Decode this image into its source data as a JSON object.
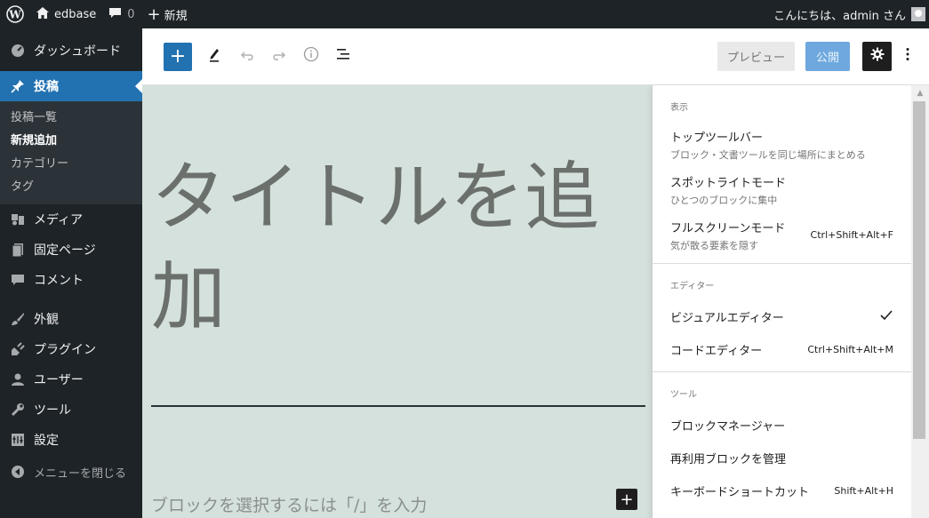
{
  "adminbar": {
    "site_name": "edbase",
    "comments_count": "0",
    "new_label": "新規",
    "greeting": "こんにちは、admin さん"
  },
  "sidebar": {
    "dashboard": "ダッシュボード",
    "posts": "投稿",
    "posts_sub": [
      "投稿一覧",
      "新規追加",
      "カテゴリー",
      "タグ"
    ],
    "media": "メディア",
    "pages": "固定ページ",
    "comments": "コメント",
    "appearance": "外観",
    "plugins": "プラグイン",
    "users": "ユーザー",
    "tools": "ツール",
    "settings": "設定",
    "collapse": "メニューを閉じる"
  },
  "toolbar": {
    "preview_label": "プレビュー",
    "publish_label": "公開"
  },
  "editor": {
    "title_placeholder": "タイトルを追加",
    "block_placeholder": "ブロックを選択するには「/」を入力"
  },
  "options_menu": {
    "view": {
      "label": "表示",
      "items": [
        {
          "label": "トップツールバー",
          "desc": "ブロック・文書ツールを同じ場所にまとめる",
          "shortcut": ""
        },
        {
          "label": "スポットライトモード",
          "desc": "ひとつのブロックに集中",
          "shortcut": ""
        },
        {
          "label": "フルスクリーンモード",
          "desc": "気が散る要素を隠す",
          "shortcut": "Ctrl+Shift+Alt+F"
        }
      ]
    },
    "editor": {
      "label": "エディター",
      "items": [
        {
          "label": "ビジュアルエディター",
          "shortcut": "",
          "checked": true
        },
        {
          "label": "コードエディター",
          "shortcut": "Ctrl+Shift+Alt+M",
          "checked": false
        }
      ]
    },
    "tools": {
      "label": "ツール",
      "items": [
        {
          "label": "ブロックマネージャー",
          "shortcut": ""
        },
        {
          "label": "再利用ブロックを管理",
          "shortcut": ""
        },
        {
          "label": "キーボードショートカット",
          "shortcut": "Shift+Alt+H"
        }
      ]
    }
  },
  "colors": {
    "admin_dark": "#1d2327",
    "accent": "#2271b1",
    "canvas_bg": "#d5e1dc",
    "publish_bg": "#6ea8de"
  }
}
